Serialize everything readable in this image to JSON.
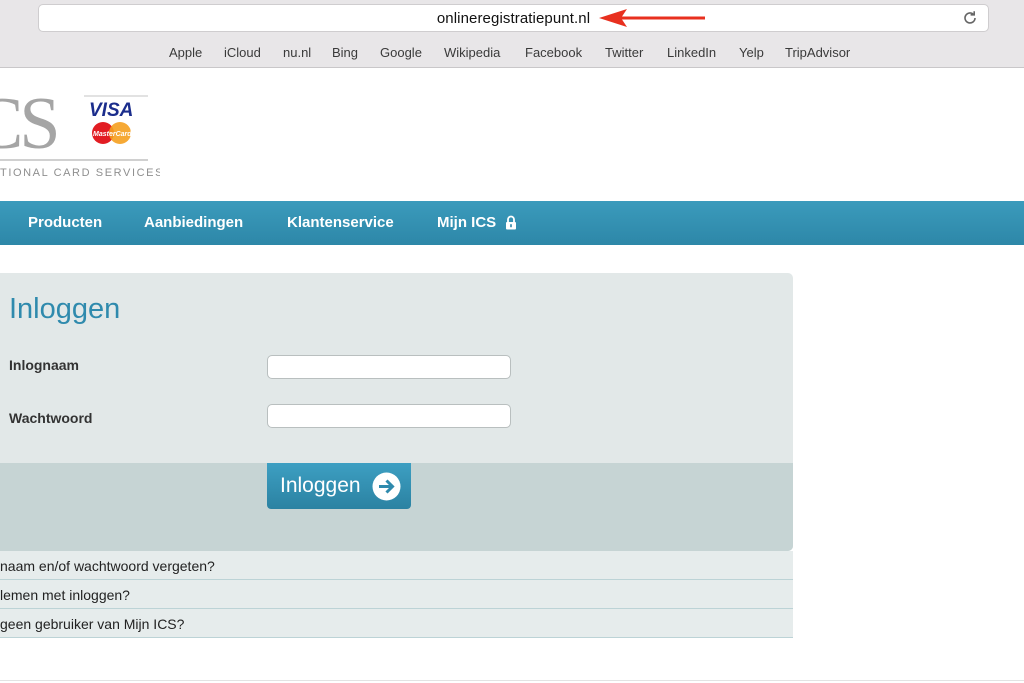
{
  "browser": {
    "url": "onlineregistratiepunt.nl",
    "bookmarks": [
      "Apple",
      "iCloud",
      "nu.nl",
      "Bing",
      "Google",
      "Wikipedia",
      "Facebook",
      "Twitter",
      "LinkedIn",
      "Yelp",
      "TripAdvisor"
    ],
    "annotation_color": "#e8301f"
  },
  "logo": {
    "lettering": "CS",
    "tagline": "TIONAL CARD SERVICES",
    "visa": "VISA",
    "mastercard": "MasterCard"
  },
  "nav": {
    "items": [
      "Producten",
      "Aanbiedingen",
      "Klantenservice",
      "Mijn ICS"
    ],
    "lock_icon": "lock-icon",
    "color": "#3497b8"
  },
  "login": {
    "title": "Inloggen",
    "username_label": "Inlognaam",
    "username_value": "",
    "password_label": "Wachtwoord",
    "password_value": "",
    "button_label": "Inloggen",
    "button_icon": "arrow-right-circle-icon",
    "accent": "#2f8aad"
  },
  "help_links": [
    "naam en/of wachtwoord vergeten?",
    "lemen met inloggen?",
    "geen gebruiker van Mijn ICS?"
  ]
}
